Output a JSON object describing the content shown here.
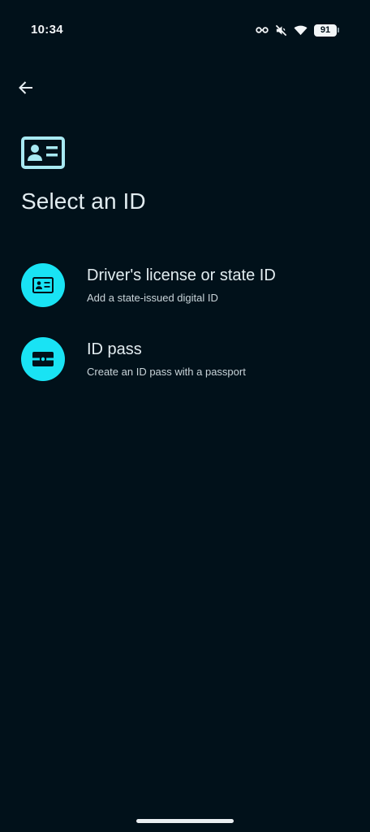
{
  "status_bar": {
    "time": "10:34",
    "battery_level": "91",
    "icons": [
      "key-link-icon",
      "mute-icon",
      "wifi-icon",
      "battery-icon"
    ]
  },
  "header": {
    "back_icon": "arrow-back-icon",
    "header_icon": "id-card-icon",
    "title": "Select an ID"
  },
  "options": [
    {
      "icon": "id-card-icon",
      "title": "Driver's license or state ID",
      "subtitle": "Add a state-issued digital ID"
    },
    {
      "icon": "id-pass-icon",
      "title": "ID pass",
      "subtitle": "Create an ID pass with a passport"
    }
  ],
  "colors": {
    "background": "#01111a",
    "accent": "#19e3f4",
    "header_icon": "#a8e9f2",
    "text_primary": "#e2ecf0",
    "text_secondary": "#c9d4d9"
  }
}
